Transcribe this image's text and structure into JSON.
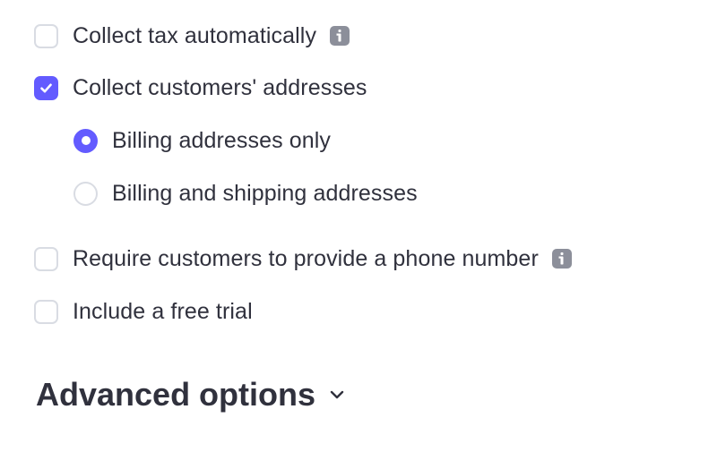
{
  "options": {
    "collect_tax": {
      "label": "Collect tax automatically",
      "checked": false,
      "has_info": true
    },
    "collect_addresses": {
      "label": "Collect customers' addresses",
      "checked": true
    },
    "address_modes": [
      {
        "label": "Billing addresses only",
        "selected": true
      },
      {
        "label": "Billing and shipping addresses",
        "selected": false
      }
    ],
    "require_phone": {
      "label": "Require customers to provide a phone number",
      "checked": false,
      "has_info": true
    },
    "free_trial": {
      "label": "Include a free trial",
      "checked": false
    }
  },
  "advanced": {
    "title": "Advanced options",
    "icon": "chevron-down-icon"
  },
  "colors": {
    "accent": "#635bff",
    "text": "#30313d",
    "border": "#d9dce3",
    "info_icon": "#8c8f9a"
  }
}
